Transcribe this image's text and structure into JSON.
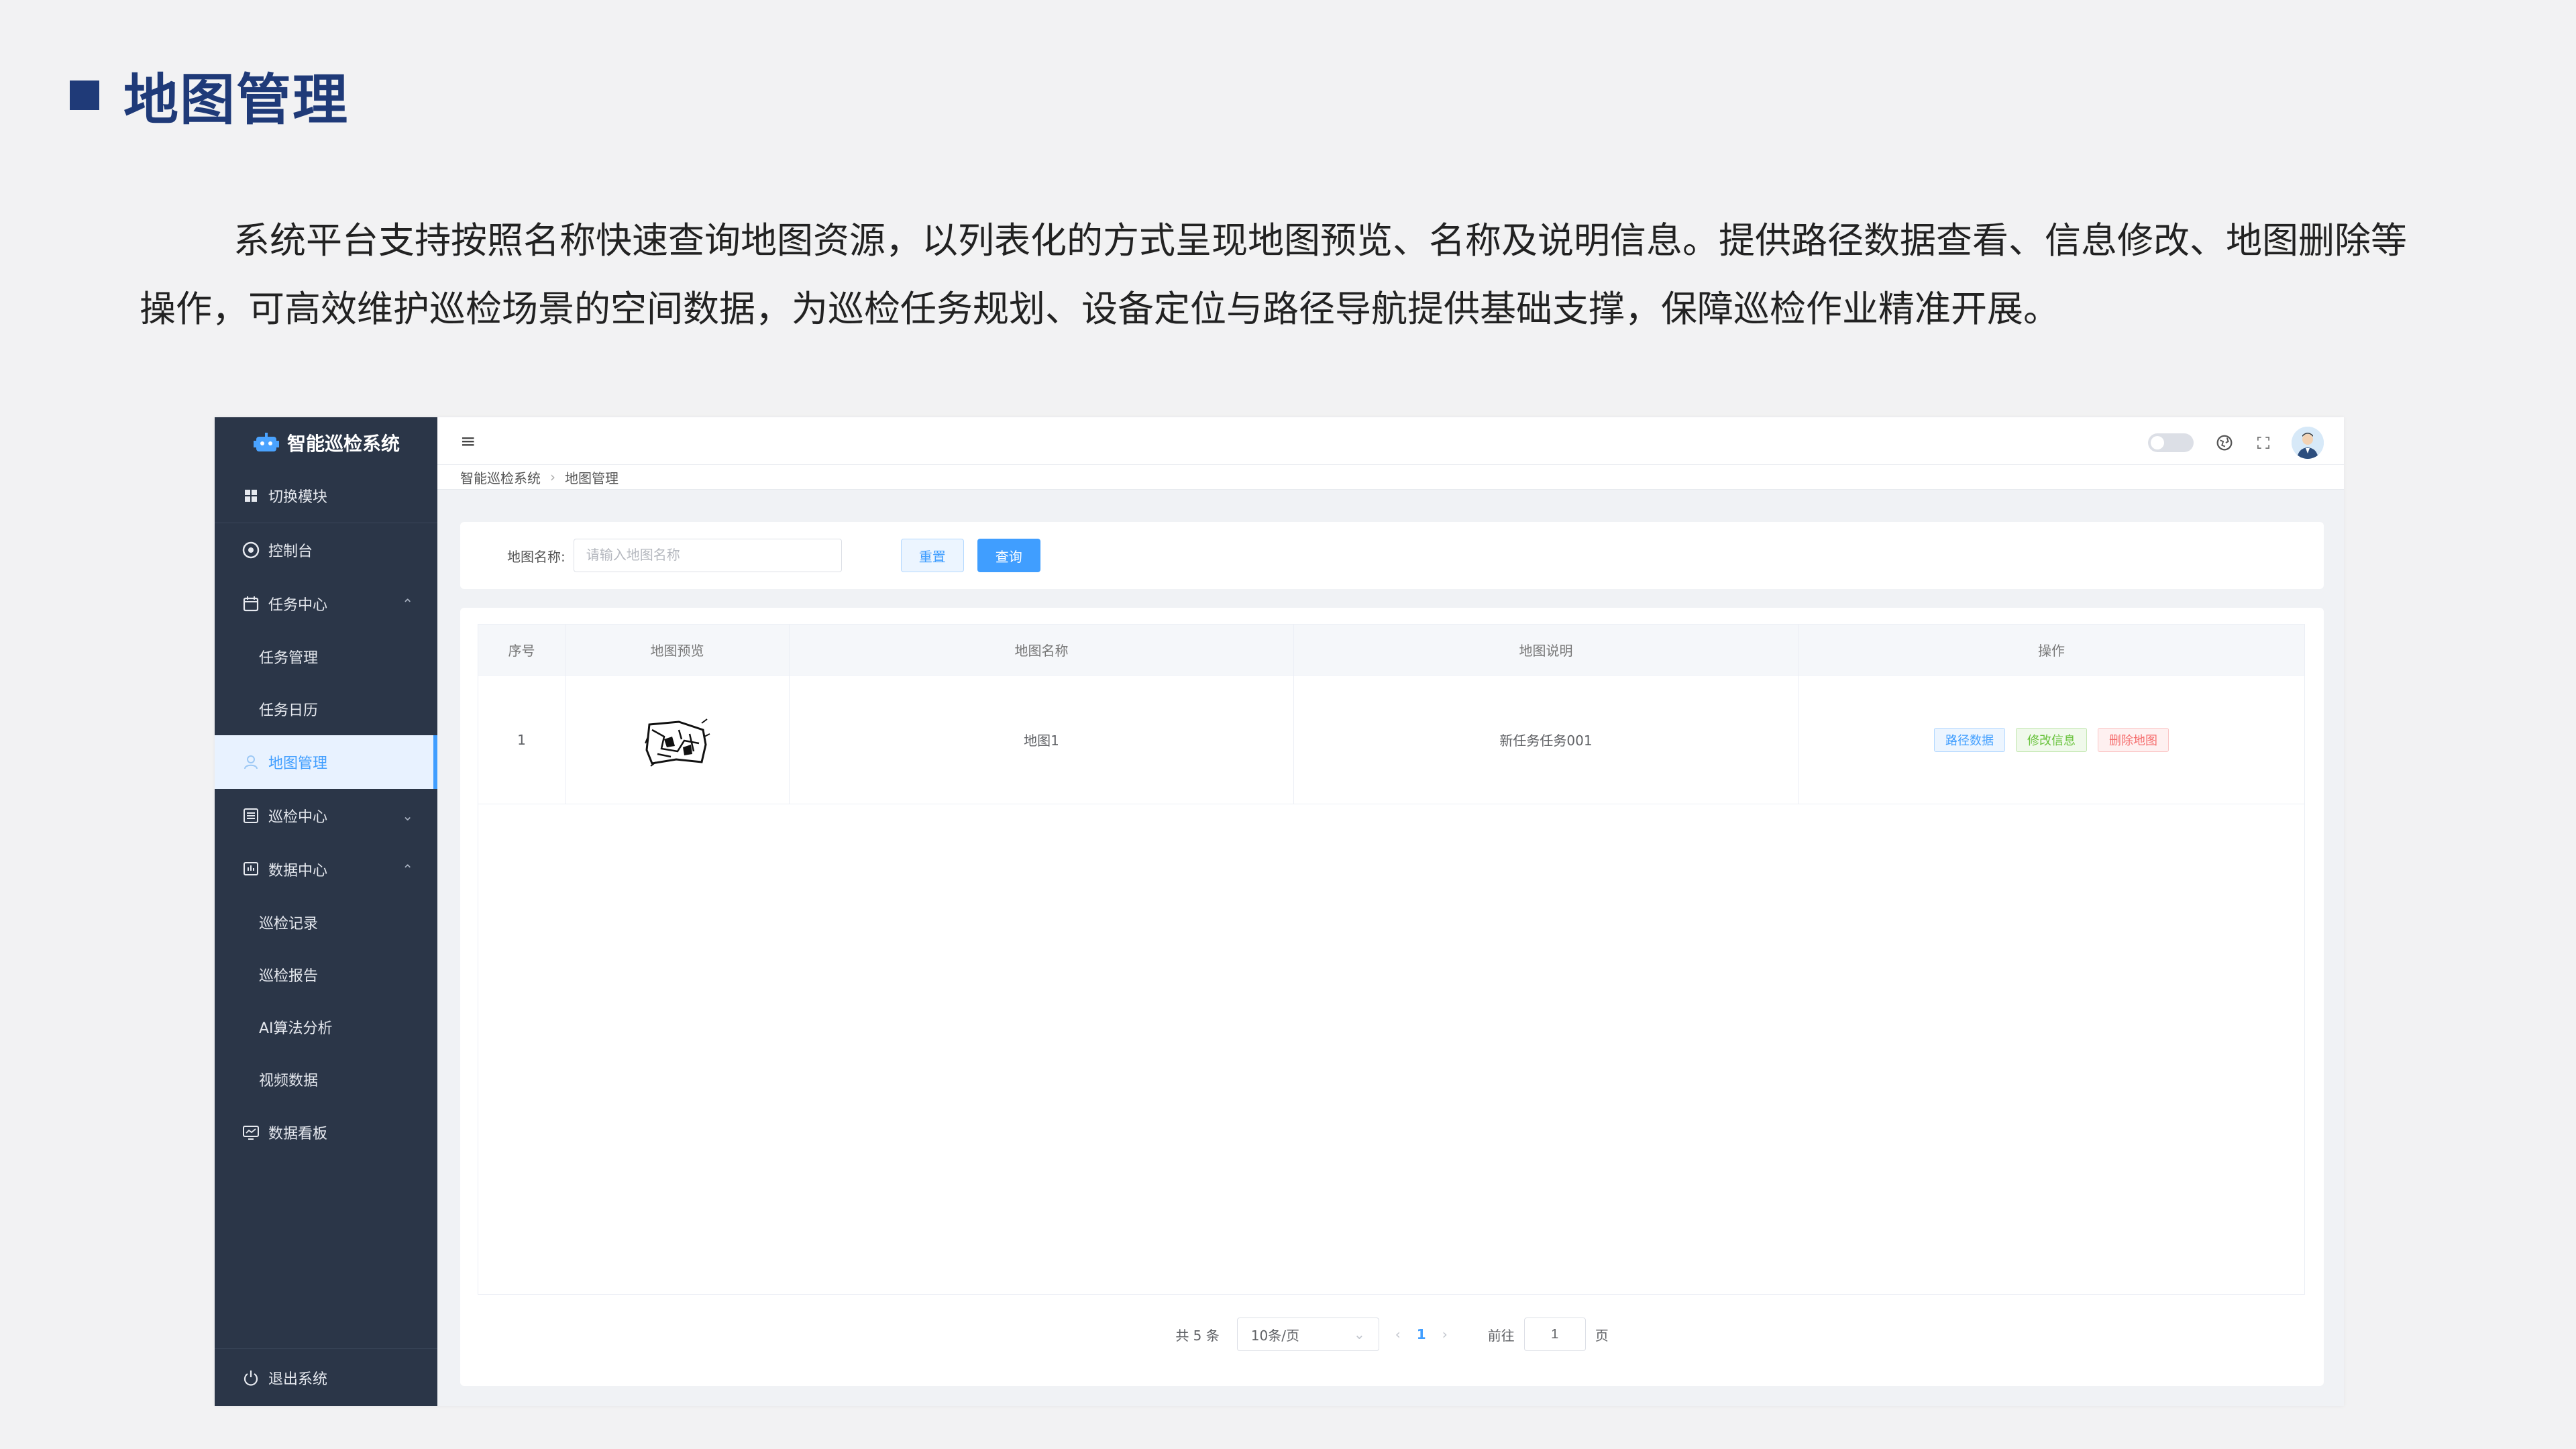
{
  "slide": {
    "title": "地图管理",
    "description": "系统平台支持按照名称快速查询地图资源，以列表化的方式呈现地图预览、名称及说明信息。提供路径数据查看、信息修改、地图删除等操作，可高效维护巡检场景的空间数据，为巡检任务规划、设备定位与路径导航提供基础支撑，保障巡检作业精准开展。"
  },
  "sidebar": {
    "brand": "智能巡检系统",
    "switch_module": "切换模块",
    "items": [
      {
        "label": "控制台",
        "icon": "dashboard-icon"
      },
      {
        "label": "任务中心",
        "icon": "calendar-icon",
        "expanded": true
      },
      {
        "label": "任务管理",
        "sub": true
      },
      {
        "label": "任务日历",
        "sub": true
      },
      {
        "label": "地图管理",
        "icon": "user-icon",
        "active": true
      },
      {
        "label": "巡检中心",
        "icon": "list-icon",
        "expanded": false
      },
      {
        "label": "数据中心",
        "icon": "chart-icon",
        "expanded": true
      },
      {
        "label": "巡检记录",
        "sub": true
      },
      {
        "label": "巡检报告",
        "sub": true
      },
      {
        "label": "AI算法分析",
        "sub": true
      },
      {
        "label": "视频数据",
        "sub": true
      },
      {
        "label": "数据看板",
        "icon": "monitor-icon"
      }
    ],
    "logout": "退出系统"
  },
  "breadcrumb": {
    "root": "智能巡检系统",
    "current": "地图管理"
  },
  "search": {
    "label": "地图名称:",
    "placeholder": "请输入地图名称",
    "reset_label": "重置",
    "query_label": "查询"
  },
  "table": {
    "headers": [
      "序号",
      "地图预览",
      "地图名称",
      "地图说明",
      "操作"
    ],
    "rows": [
      {
        "index": "1",
        "name": "地图1",
        "description": "新任务任务001"
      }
    ],
    "actions": {
      "path": "路径数据",
      "edit": "修改信息",
      "delete": "删除地图"
    }
  },
  "pagination": {
    "total": "共 5 条",
    "page_size": "10条/页",
    "prev": "‹",
    "current": "1",
    "next": "›",
    "goto": "前往",
    "goto_value": "1",
    "unit": "页"
  },
  "colors": {
    "accent": "#409eff",
    "sidebar": "#2b3648",
    "title": "#1f3a78"
  }
}
